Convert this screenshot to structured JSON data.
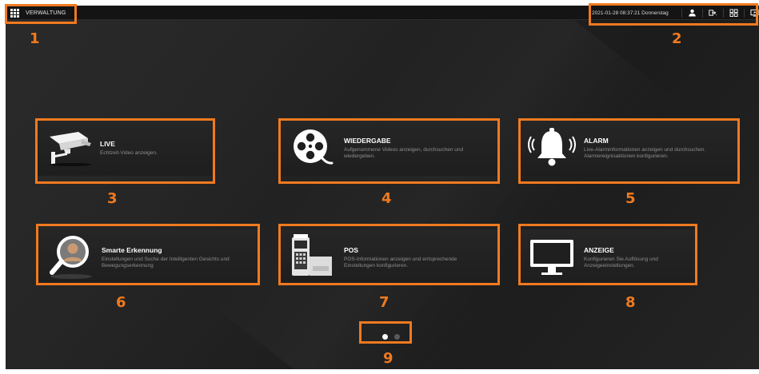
{
  "topbar": {
    "app_title": "VERWALTUNG",
    "datetime": "2021-01-28 08:37:21 Donnerstag",
    "icons": [
      "apps-grid-icon",
      "user-icon",
      "logout-icon",
      "multiscreen-icon",
      "live-view-icon"
    ]
  },
  "tiles": [
    {
      "id": "live",
      "title": "LIVE",
      "desc": "Echtzeit-Video anzeigen.",
      "icon": "camera-icon",
      "marker": "3"
    },
    {
      "id": "wiedergabe",
      "title": "WIEDERGABE",
      "desc": "Aufgenommene Videos anzeigen, durchsuchen und wiedergeben.",
      "icon": "film-reel-icon",
      "marker": "4"
    },
    {
      "id": "alarm",
      "title": "ALARM",
      "desc": "Live-Alarminformationen anzeigen und durchsuchen. Alarmereignisaktionen konfigurieren.",
      "icon": "alarm-bell-icon",
      "marker": "5"
    },
    {
      "id": "smarte",
      "title": "Smarte Erkennung",
      "desc": "Einstellungen und Suche der Intelligenten Gesichts und Bewegungserkennung",
      "icon": "face-search-icon",
      "marker": "6"
    },
    {
      "id": "pos",
      "title": "POS",
      "desc": "POS-Informationen anzeigen und entsprechende Einstellungen konfigurieren.",
      "icon": "pos-terminal-icon",
      "marker": "7"
    },
    {
      "id": "anzeige",
      "title": "ANZEIGE",
      "desc": "Konfigurieren Sie Auflösung und Anzeigeeinstellungen.",
      "icon": "monitor-icon",
      "marker": "8"
    }
  ],
  "markers": {
    "topbar_left": "1",
    "topbar_right": "2",
    "pagination": "9"
  },
  "pagination": {
    "pages": 2,
    "current": 1
  },
  "colors": {
    "accent_orange": "#f07a1f",
    "background": "#222222",
    "tile_bg": "#232323",
    "title_text": "#ffffff",
    "desc_text": "#8e8e8e"
  }
}
